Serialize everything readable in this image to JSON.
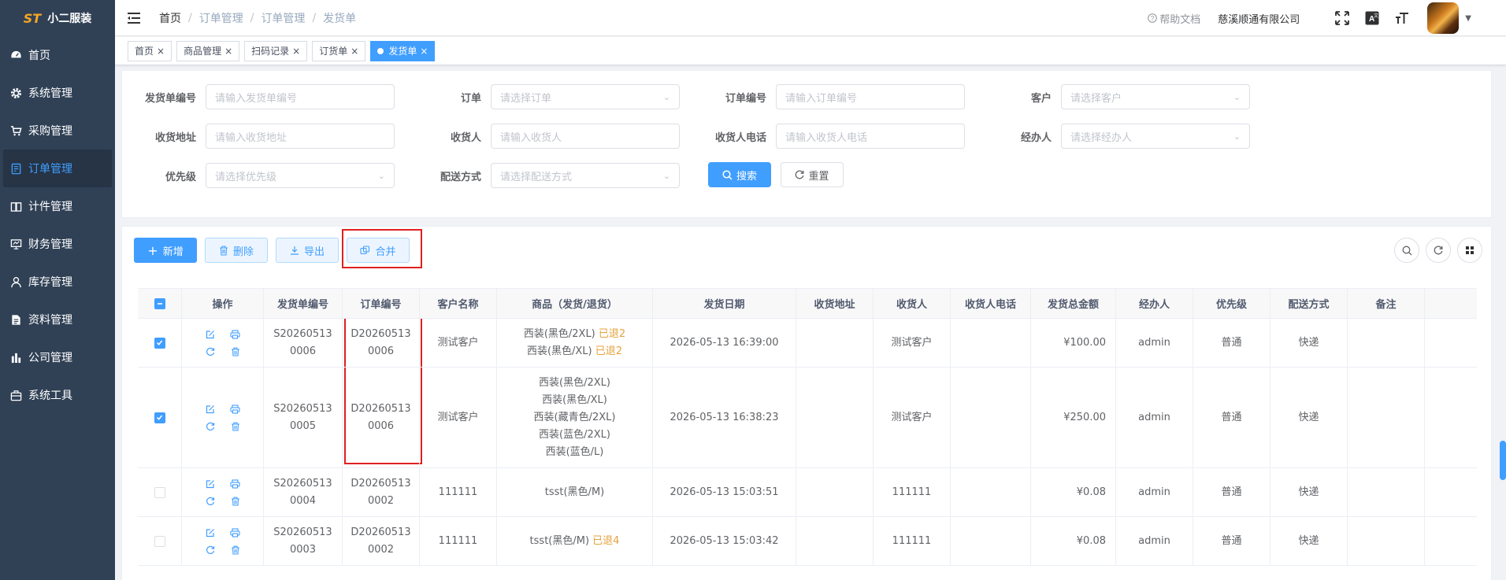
{
  "app": {
    "logo_mark": "ST",
    "name": "小二服装"
  },
  "sidebar": {
    "items": [
      {
        "label": "首页",
        "icon": "dashboard-icon",
        "active": false
      },
      {
        "label": "系统管理",
        "icon": "gear-icon",
        "active": false
      },
      {
        "label": "采购管理",
        "icon": "cart-icon",
        "active": false
      },
      {
        "label": "订单管理",
        "icon": "order-icon",
        "active": true
      },
      {
        "label": "计件管理",
        "icon": "book-icon",
        "active": false
      },
      {
        "label": "财务管理",
        "icon": "monitor-icon",
        "active": false
      },
      {
        "label": "库存管理",
        "icon": "user-icon",
        "active": false
      },
      {
        "label": "资料管理",
        "icon": "document-icon",
        "active": false
      },
      {
        "label": "公司管理",
        "icon": "bar-chart-icon",
        "active": false
      },
      {
        "label": "系统工具",
        "icon": "toolbox-icon",
        "active": false
      }
    ]
  },
  "header": {
    "breadcrumb": [
      "首页",
      "订单管理",
      "订单管理",
      "发货单"
    ],
    "help": "帮助文档",
    "company": "慈溪顺通有限公司"
  },
  "tags": [
    {
      "label": "首页",
      "active": false
    },
    {
      "label": "商品管理",
      "active": false
    },
    {
      "label": "扫码记录",
      "active": false
    },
    {
      "label": "订货单",
      "active": false
    },
    {
      "label": "发货单",
      "active": true
    }
  ],
  "filters": {
    "row1": [
      {
        "label": "发货单编号",
        "placeholder": "请输入发货单编号",
        "select": false
      },
      {
        "label": "订单",
        "placeholder": "请选择订单",
        "select": true
      },
      {
        "label": "订单编号",
        "placeholder": "请输入订单编号",
        "select": false
      },
      {
        "label": "客户",
        "placeholder": "请选择客户",
        "select": true
      }
    ],
    "row2": [
      {
        "label": "收货地址",
        "placeholder": "请输入收货地址",
        "select": false
      },
      {
        "label": "收货人",
        "placeholder": "请输入收货人",
        "select": false
      },
      {
        "label": "收货人电话",
        "placeholder": "请输入收货人电话",
        "select": false
      },
      {
        "label": "经办人",
        "placeholder": "请选择经办人",
        "select": true
      }
    ],
    "row3": [
      {
        "label": "优先级",
        "placeholder": "请选择优先级",
        "select": true
      },
      {
        "label": "配送方式",
        "placeholder": "请选择配送方式",
        "select": true
      }
    ],
    "search_label": "搜索",
    "reset_label": "重置"
  },
  "toolbar": {
    "add": "新增",
    "delete": "删除",
    "export": "导出",
    "merge": "合并"
  },
  "table": {
    "columns": [
      "",
      "操作",
      "发货单编号",
      "订单编号",
      "客户名称",
      "商品（发货/退货）",
      "发货日期",
      "收货地址",
      "收货人",
      "收货人电话",
      "发货总金额",
      "经办人",
      "优先级",
      "配送方式",
      "备注"
    ],
    "rows": [
      {
        "checked": true,
        "shipment_no": [
          "S20260513",
          "0006"
        ],
        "order_no": [
          "D20260513",
          "0006"
        ],
        "customer": "测试客户",
        "goods": [
          {
            "name": "西装(黑色/2XL)",
            "returned": "已退2"
          },
          {
            "name": "西装(黑色/XL)",
            "returned": "已退2"
          }
        ],
        "date": "2026-05-13 16:39:00",
        "address": "",
        "receiver": "测试客户",
        "phone": "",
        "amount": "¥100.00",
        "handler": "admin",
        "priority": "普通",
        "delivery": "快递",
        "remark": ""
      },
      {
        "checked": true,
        "shipment_no": [
          "S20260513",
          "0005"
        ],
        "order_no": [
          "D20260513",
          "0006"
        ],
        "customer": "测试客户",
        "goods": [
          {
            "name": "西装(黑色/2XL)",
            "returned": ""
          },
          {
            "name": "西装(黑色/XL)",
            "returned": ""
          },
          {
            "name": "西装(藏青色/2XL)",
            "returned": ""
          },
          {
            "name": "西装(蓝色/2XL)",
            "returned": ""
          },
          {
            "name": "西装(蓝色/L)",
            "returned": ""
          }
        ],
        "date": "2026-05-13 16:38:23",
        "address": "",
        "receiver": "测试客户",
        "phone": "",
        "amount": "¥250.00",
        "handler": "admin",
        "priority": "普通",
        "delivery": "快递",
        "remark": ""
      },
      {
        "checked": false,
        "shipment_no": [
          "S20260513",
          "0004"
        ],
        "order_no": [
          "D20260513",
          "0002"
        ],
        "customer": "111111",
        "goods": [
          {
            "name": "tsst(黑色/M)",
            "returned": ""
          }
        ],
        "date": "2026-05-13 15:03:51",
        "address": "",
        "receiver": "111111",
        "phone": "",
        "amount": "¥0.08",
        "handler": "admin",
        "priority": "普通",
        "delivery": "快递",
        "remark": ""
      },
      {
        "checked": false,
        "shipment_no": [
          "S20260513",
          "0003"
        ],
        "order_no": [
          "D20260513",
          "0002"
        ],
        "customer": "111111",
        "goods": [
          {
            "name": "tsst(黑色/M)",
            "returned": "已退4"
          }
        ],
        "date": "2026-05-13 15:03:42",
        "address": "",
        "receiver": "111111",
        "phone": "",
        "amount": "¥0.08",
        "handler": "admin",
        "priority": "普通",
        "delivery": "快递",
        "remark": ""
      }
    ]
  }
}
